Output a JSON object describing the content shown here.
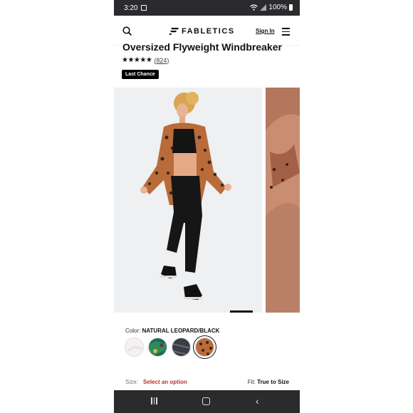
{
  "status_bar": {
    "time": "3:20",
    "battery": "100%"
  },
  "header": {
    "brand": "FABLETICS",
    "signin_label": "Sign In"
  },
  "product": {
    "title": "Oversized Flyweight Windbreaker",
    "stars": "★★★★★",
    "review_count": "(824)",
    "badge": "Last Chance"
  },
  "color": {
    "label": "Color:",
    "selected_name": "NATURAL LEOPARD/BLACK",
    "swatches": [
      "white",
      "green-print",
      "charcoal-print",
      "leopard"
    ]
  },
  "size": {
    "label": "Size:",
    "value": "Select an option"
  },
  "fit": {
    "label": "Fit:",
    "value": "True to Size"
  },
  "colors": {
    "accent_red": "#b5352a",
    "bar_dark": "#2b2b2d"
  },
  "icons": [
    "search-icon",
    "fabletics-logo-icon",
    "menu-icon",
    "recents-icon",
    "home-icon",
    "back-icon"
  ]
}
